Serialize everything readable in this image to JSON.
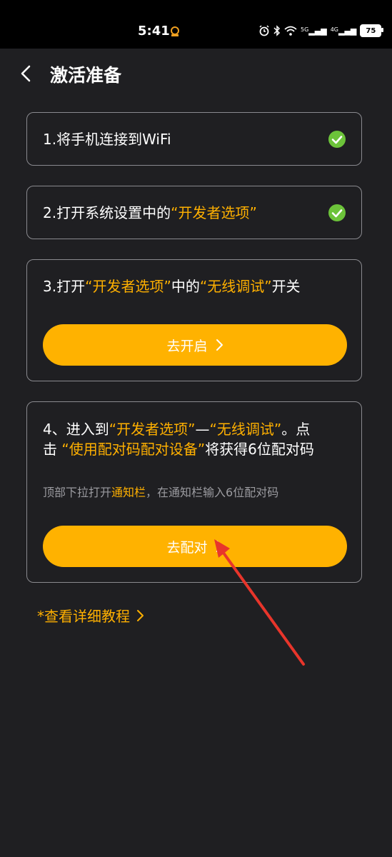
{
  "status_bar": {
    "time": "5:41",
    "battery": "75",
    "net1": "5G",
    "net2": "4G"
  },
  "header": {
    "title": "激活准备"
  },
  "steps": [
    {
      "text": "1.将手机连接到WiFi"
    },
    {
      "prefix": "2.打开系统设置中的",
      "highlight": "“开发者选项”"
    },
    {
      "prefix": "3.打开",
      "highlight1": "“开发者选项”",
      "middle": "中的",
      "highlight2": "“无线调试”",
      "suffix": "开关",
      "button": "去开启"
    },
    {
      "line1_prefix": "4、进入到",
      "line1_hl1": "“开发者选项”",
      "line1_dash": "—",
      "line1_hl2": "“无线调试”",
      "line1_suffix": "。点",
      "line2_prefix": "击 ",
      "line2_hl": "“使用配对码配对设备”",
      "line2_suffix": "将获得6位配对码",
      "hint_prefix": "顶部下拉打开",
      "hint_hl": "通知栏",
      "hint_suffix": "，在通知栏输入6位配对码",
      "button": "去配对"
    }
  ],
  "tutorial_link": "*查看详细教程",
  "colors": {
    "accent": "#ffb200",
    "check": "#6cc33a",
    "background": "#1f1f22",
    "annotation": "#e8352b"
  }
}
